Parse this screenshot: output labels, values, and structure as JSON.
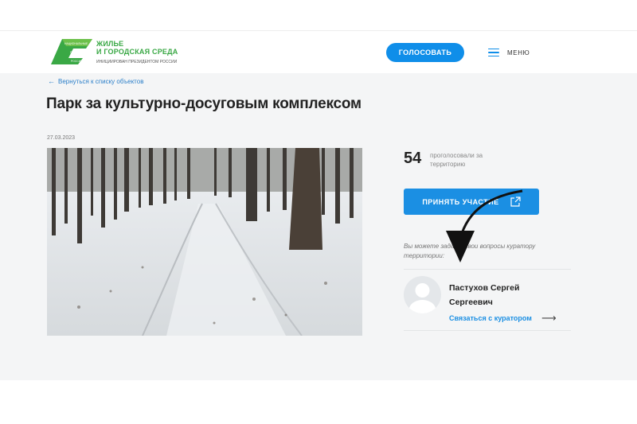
{
  "header": {
    "logo_mark_text": "НАЦИОНАЛЬНЫЕ ПРОЕКТЫ РОССИИ",
    "logo_title": "ЖИЛЬЕ\nИ ГОРОДСКАЯ СРЕДА",
    "logo_subtitle": "ИНИЦИИРОВАН ПРЕЗИДЕНТОМ РОССИИ",
    "vote_button": "ГОЛОСОВАТЬ",
    "menu_label": "МЕНЮ",
    "menu_icon": "hamburger-icon"
  },
  "main": {
    "back_link": "Вернуться к списку объектов",
    "back_icon": "arrow-left-icon",
    "title": "Парк за культурно-досуговым комплексом",
    "date": "27.03.2023",
    "photo_alt": "photo"
  },
  "sidebar": {
    "votes_count": "54",
    "votes_label": "проголосовали за территорию",
    "join_button": "ПРИНЯТЬ УЧАСТИЕ",
    "join_icon": "external-link-icon",
    "hint": "Вы можете задать свои вопросы куратору территории:",
    "curator_name": "Пастухов Сергей Сергеевич",
    "curator_link": "Связаться с куратором",
    "curator_link_icon": "arrow-right-icon"
  },
  "colors": {
    "accent": "#1b8fe3",
    "logo_green": "#3aa845",
    "background_gray": "#f4f5f6"
  }
}
